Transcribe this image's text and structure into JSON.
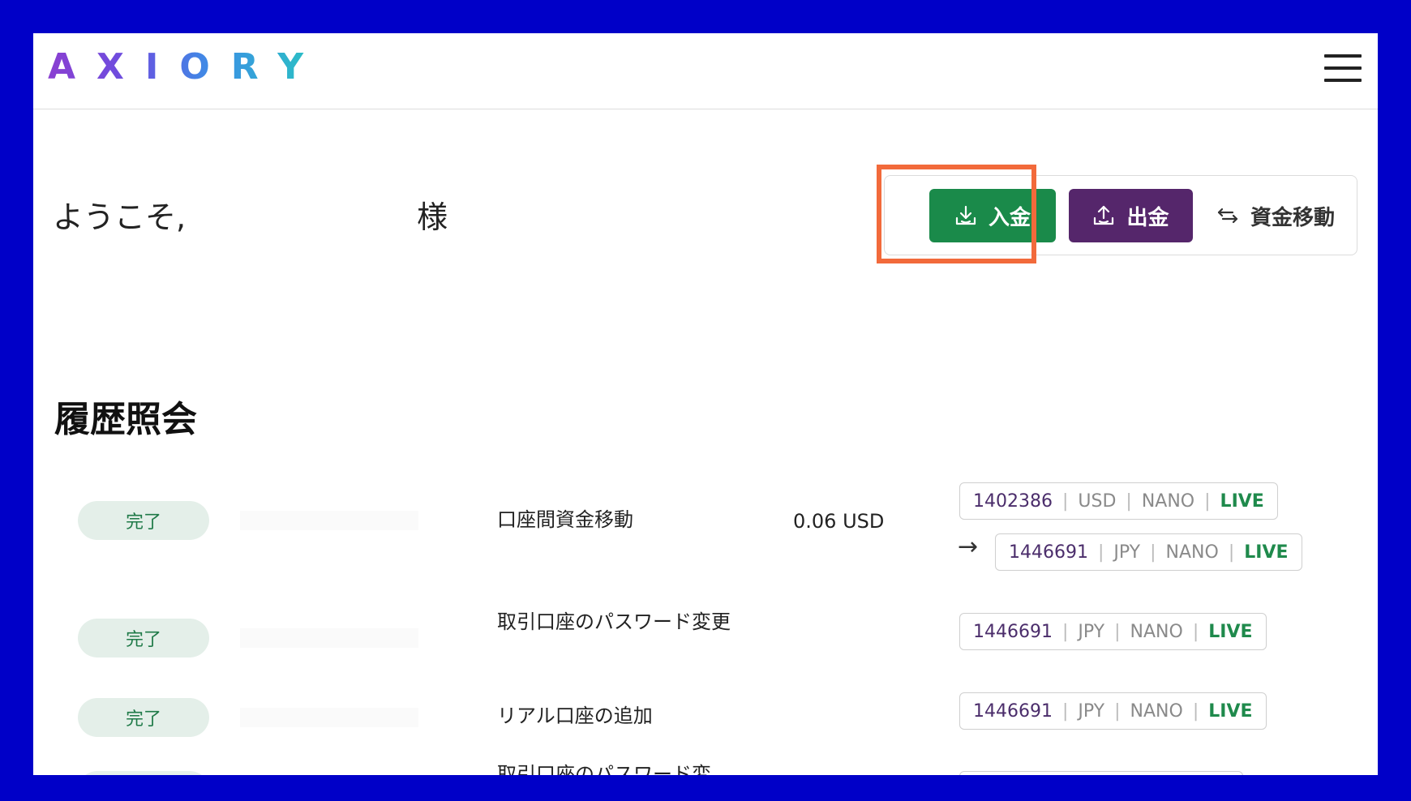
{
  "header": {
    "logo_text": "AXIORY",
    "menu_icon": "hamburger-menu-icon"
  },
  "welcome": {
    "greeting": "ようこそ,",
    "suffix": "様"
  },
  "actions": {
    "deposit_label": "入金",
    "withdraw_label": "出金",
    "transfer_label": "資金移動"
  },
  "history": {
    "title": "履歴照会",
    "rows": [
      {
        "status": "完了",
        "description": "口座間資金移動",
        "amount": "0.06 USD",
        "from_account": {
          "number": "1402386",
          "currency": "USD",
          "type": "NANO",
          "mode": "LIVE"
        },
        "to_account": {
          "number": "1446691",
          "currency": "JPY",
          "type": "NANO",
          "mode": "LIVE"
        }
      },
      {
        "status": "完了",
        "description": "取引口座のパスワード変更",
        "amount": "",
        "account": {
          "number": "1446691",
          "currency": "JPY",
          "type": "NANO",
          "mode": "LIVE"
        }
      },
      {
        "status": "完了",
        "description": "リアル口座の追加",
        "amount": "",
        "account": {
          "number": "1446691",
          "currency": "JPY",
          "type": "NANO",
          "mode": "LIVE"
        }
      },
      {
        "status": "",
        "description": "取引口座のパスワード変",
        "amount": ""
      }
    ]
  },
  "colors": {
    "deposit": "#1a8a4a",
    "withdraw": "#55266b",
    "highlight": "#f26a3b",
    "frame": "#0000c8"
  }
}
